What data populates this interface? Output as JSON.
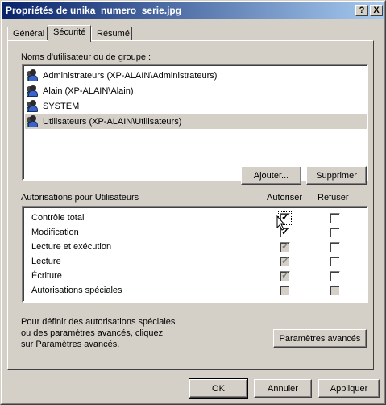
{
  "window": {
    "title": "Propriétés de unika_numero_serie.jpg",
    "help_btn": "?",
    "close_btn": "X"
  },
  "tabs": [
    {
      "label": "Général",
      "active": false
    },
    {
      "label": "Sécurité",
      "active": true
    },
    {
      "label": "Résumé",
      "active": false
    }
  ],
  "users_section": {
    "label": "Noms d'utilisateur ou de groupe :",
    "items": [
      {
        "name": "Administrateurs (XP-ALAIN\\Administrateurs)",
        "icon": "group-icon",
        "selected": false
      },
      {
        "name": "Alain (XP-ALAIN\\Alain)",
        "icon": "group-icon",
        "selected": false
      },
      {
        "name": "SYSTEM",
        "icon": "group-icon",
        "selected": false
      },
      {
        "name": "Utilisateurs (XP-ALAIN\\Utilisateurs)",
        "icon": "group-icon",
        "selected": true
      }
    ],
    "add_button": "Ajouter...",
    "remove_button": "Supprimer"
  },
  "permissions": {
    "label": "Autorisations pour Utilisateurs",
    "col_allow": "Autoriser",
    "col_deny": "Refuser",
    "rows": [
      {
        "name": "Contrôle total",
        "allow": true,
        "allow_enabled": true,
        "deny": false,
        "deny_enabled": true
      },
      {
        "name": "Modification",
        "allow": true,
        "allow_enabled": true,
        "deny": false,
        "deny_enabled": true
      },
      {
        "name": "Lecture et exécution",
        "allow": true,
        "allow_enabled": false,
        "deny": false,
        "deny_enabled": true
      },
      {
        "name": "Lecture",
        "allow": true,
        "allow_enabled": false,
        "deny": false,
        "deny_enabled": true
      },
      {
        "name": "Écriture",
        "allow": true,
        "allow_enabled": false,
        "deny": false,
        "deny_enabled": true
      },
      {
        "name": "Autorisations spéciales",
        "allow": false,
        "allow_enabled": false,
        "deny": false,
        "deny_enabled": false
      }
    ]
  },
  "advanced": {
    "text_line1": "Pour définir des autorisations spéciales",
    "text_line2": "ou des paramètres avancés, cliquez",
    "text_line3": "sur Paramètres avancés.",
    "button": "Paramètres avancés"
  },
  "footer": {
    "ok": "OK",
    "cancel": "Annuler",
    "apply": "Appliquer"
  },
  "colors": {
    "title_start": "#0a246a",
    "title_end": "#a6caf0",
    "face": "#d4d0c8"
  }
}
